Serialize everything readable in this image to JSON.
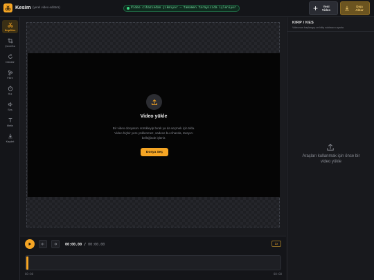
{
  "header": {
    "app_name": "Kesim",
    "app_subtitle": "(yerel video editörü)",
    "status_text": "Video cihazından çıkmıyor — tamamen tarayıcıda işleniyor",
    "new_video_label": "Yeni Video",
    "export_label": "Dışa Aktar"
  },
  "tools": [
    {
      "label": "Kırp/Kes",
      "icon": "scissors-icon",
      "active": true
    },
    {
      "label": "Çevir/Ka",
      "icon": "crop-icon",
      "active": false
    },
    {
      "label": "Döndür",
      "icon": "rotate-icon",
      "active": false
    },
    {
      "label": "Filtre",
      "icon": "filter-icon",
      "active": false
    },
    {
      "label": "Hız",
      "icon": "speed-icon",
      "active": false
    },
    {
      "label": "Ses",
      "icon": "volume-icon",
      "active": false
    },
    {
      "label": "Metin",
      "icon": "text-icon",
      "active": false
    },
    {
      "label": "Kaydet",
      "icon": "download-icon",
      "active": false
    }
  ],
  "stage": {
    "upload_title": "Video yükle",
    "upload_description": "Bir video dosyasını sürükleyip bırak ya da seçmek için tıkla. Video hiçbir yere yüklenmez, sadece bu cihazda, tarayıcı belleğinde işlenir.",
    "choose_file_label": "Dosya Seç"
  },
  "panel": {
    "title": "KIRP / KES",
    "subtitle": "Videonun başlangıç ve bitiş noktasını ayarla",
    "empty_hint": "Araçları kullanmak için önce bir video yükle"
  },
  "transport": {
    "current_time": "00:00.00",
    "separator": "/",
    "total_time": "00:00.00",
    "speed": "1x",
    "ticks": [
      "00:00",
      "00:00"
    ]
  },
  "colors": {
    "accent": "#f5a524",
    "status_green": "#3ddc84",
    "background": "#16171b"
  }
}
